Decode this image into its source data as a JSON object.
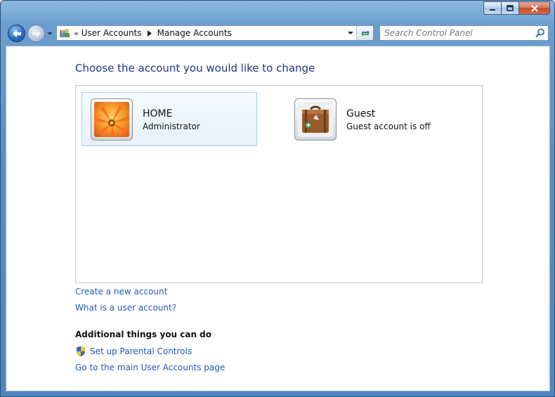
{
  "window": {
    "controls": {
      "minimize_icon": "minimize-icon",
      "maximize_icon": "maximize-icon",
      "close_icon": "close-icon"
    }
  },
  "navigation": {
    "back_icon": "back-arrow-icon",
    "forward_icon": "forward-arrow-icon",
    "address": {
      "chevron": "«",
      "segments": [
        "User Accounts",
        "Manage Accounts"
      ]
    },
    "search": {
      "placeholder": "Search Control Panel"
    }
  },
  "main": {
    "heading": "Choose the account you would like to change",
    "accounts": [
      {
        "name": "HOME",
        "detail": "Administrator",
        "picture": "flower-picture",
        "selected": true
      },
      {
        "name": "Guest",
        "detail": "Guest account is off",
        "picture": "suitcase-picture",
        "selected": false
      }
    ],
    "links": [
      "Create a new account",
      "What is a user account?"
    ],
    "additional": {
      "title": "Additional things you can do",
      "links": [
        "Set up Parental Controls",
        "Go to the main User Accounts page"
      ]
    }
  },
  "colors": {
    "heading": "#1E3287",
    "link": "#1F5AB8",
    "selection": "#E7F1FB"
  }
}
